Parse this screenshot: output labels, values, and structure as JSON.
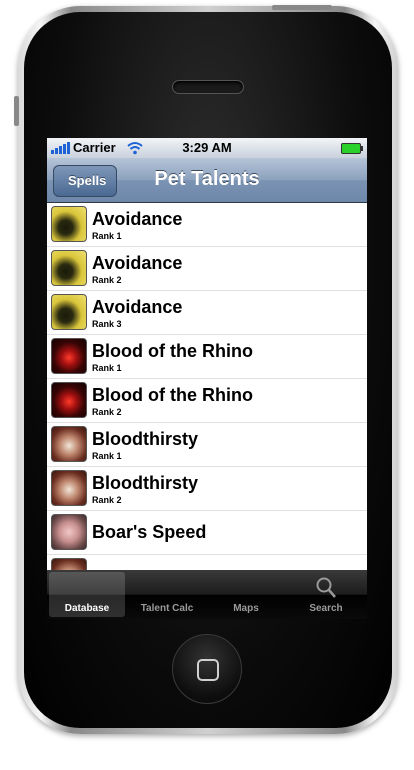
{
  "status_bar": {
    "carrier": "Carrier",
    "time": "3:29 AM"
  },
  "nav": {
    "back_label": "Spells",
    "title": "Pet Talents"
  },
  "list": {
    "items": [
      {
        "name": "Avoidance",
        "rank": "Rank 1",
        "icon": "avoidance-icon"
      },
      {
        "name": "Avoidance",
        "rank": "Rank 2",
        "icon": "avoidance-icon"
      },
      {
        "name": "Avoidance",
        "rank": "Rank 3",
        "icon": "avoidance-icon"
      },
      {
        "name": "Blood of the Rhino",
        "rank": "Rank 1",
        "icon": "blood-of-the-rhino-icon"
      },
      {
        "name": "Blood of the Rhino",
        "rank": "Rank 2",
        "icon": "blood-of-the-rhino-icon"
      },
      {
        "name": "Bloodthirsty",
        "rank": "Rank 1",
        "icon": "bloodthirsty-icon"
      },
      {
        "name": "Bloodthirsty",
        "rank": "Rank 2",
        "icon": "bloodthirsty-icon"
      },
      {
        "name": "Boar's Speed",
        "rank": "",
        "icon": "boars-speed-icon"
      }
    ]
  },
  "tabs": [
    {
      "label": "Database",
      "selected": true
    },
    {
      "label": "Talent Calc",
      "selected": false
    },
    {
      "label": "Maps",
      "selected": false
    },
    {
      "label": "Search",
      "selected": false,
      "icon": "search-icon"
    }
  ],
  "colors": {
    "nav_bar": "#7b93b3",
    "tab_bar": "#1c1c1c",
    "battery": "#2bd12b"
  }
}
